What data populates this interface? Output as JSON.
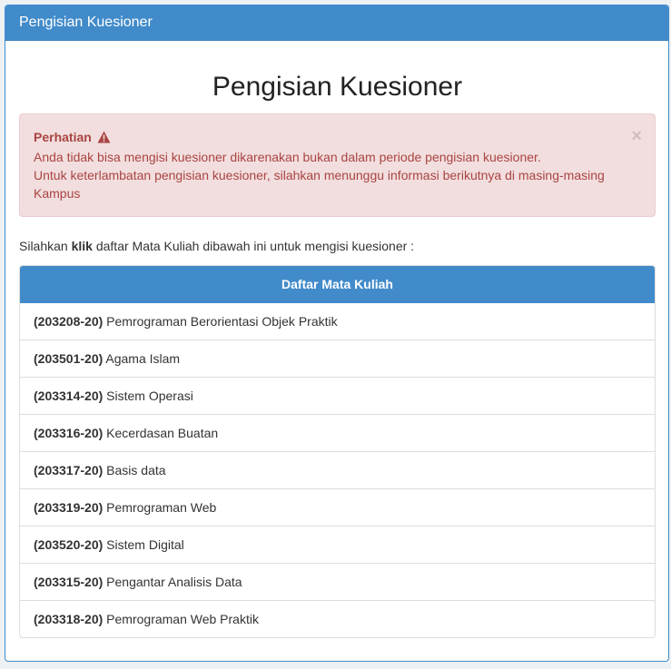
{
  "panel": {
    "heading": "Pengisian Kuesioner"
  },
  "page": {
    "title": "Pengisian Kuesioner"
  },
  "alert": {
    "title": "Perhatian",
    "line1": "Anda tidak bisa mengisi kuesioner dikarenakan bukan dalam periode pengisian kuesioner.",
    "line2": "Untuk keterlambatan pengisian kuesioner, silahkan menunggu informasi berikutnya di masing-masing Kampus",
    "close": "×"
  },
  "instruction": {
    "before": "Silahkan ",
    "bold": "klik",
    "after": " daftar Mata Kuliah dibawah ini untuk mengisi kuesioner :"
  },
  "courses": {
    "header": "Daftar Mata Kuliah",
    "items": [
      {
        "code": "(203208-20)",
        "name": " Pemrograman Berorientasi Objek Praktik"
      },
      {
        "code": "(203501-20)",
        "name": " Agama Islam"
      },
      {
        "code": "(203314-20)",
        "name": " Sistem Operasi"
      },
      {
        "code": "(203316-20)",
        "name": " Kecerdasan Buatan"
      },
      {
        "code": "(203317-20)",
        "name": " Basis data"
      },
      {
        "code": "(203319-20)",
        "name": " Pemrograman Web"
      },
      {
        "code": "(203520-20)",
        "name": " Sistem Digital"
      },
      {
        "code": "(203315-20)",
        "name": " Pengantar Analisis Data"
      },
      {
        "code": "(203318-20)",
        "name": " Pemrograman Web Praktik"
      }
    ]
  },
  "colors": {
    "primary": "#428bca",
    "alert_bg": "#f2dede",
    "alert_text": "#a94442"
  },
  "icons": {
    "alert": "warning-icon"
  }
}
